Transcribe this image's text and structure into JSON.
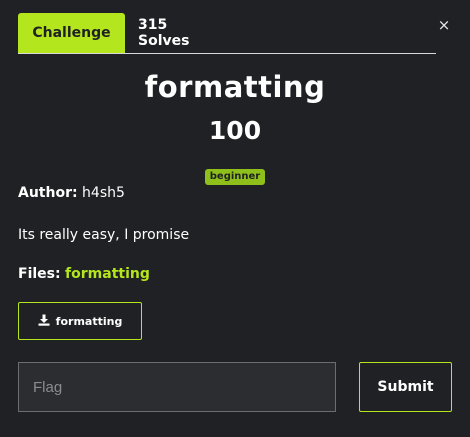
{
  "tabs": {
    "challenge_label": "Challenge",
    "solves_label": "315 Solves"
  },
  "close": {
    "glyph": "×"
  },
  "challenge": {
    "name": "formatting",
    "points": "100",
    "tag": "beginner",
    "author_label": "Author:",
    "author": "h4sh5",
    "description": "Its really easy, I promise",
    "files_label": "Files:",
    "file_link": "formatting",
    "download_button_label": "formatting"
  },
  "form": {
    "flag_placeholder": "Flag",
    "submit_label": "Submit"
  },
  "colors": {
    "accent": "#b4e61e",
    "background": "#1f2124"
  },
  "icons": [
    "close-icon",
    "download-icon"
  ]
}
